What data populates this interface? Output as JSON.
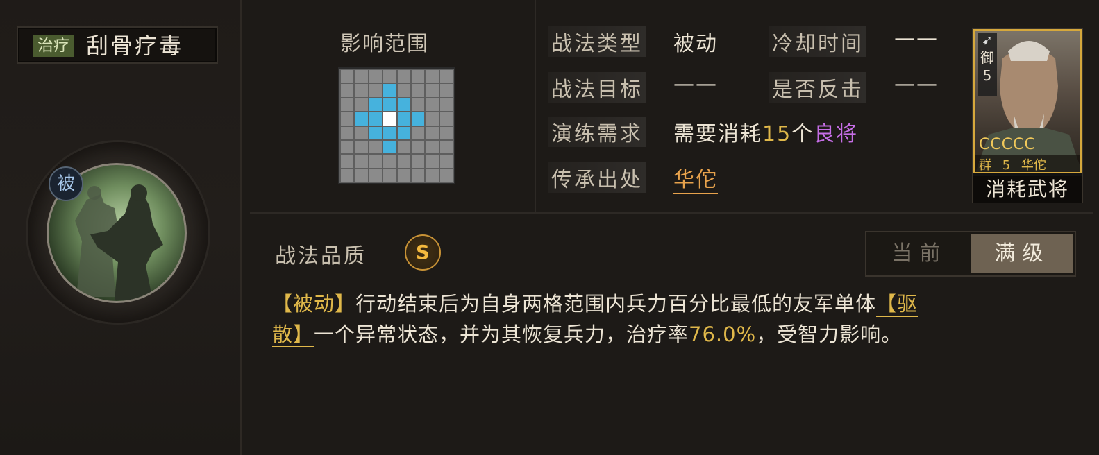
{
  "skill": {
    "type_tag": "治疗",
    "name": "刮骨疗毒",
    "passive_badge": "被",
    "icon": "silhouette-figures-icon"
  },
  "range": {
    "title": "影响范围",
    "grid_size": 8,
    "blue_cells": [
      [
        1,
        3
      ],
      [
        2,
        2
      ],
      [
        2,
        3
      ],
      [
        2,
        4
      ],
      [
        3,
        1
      ],
      [
        3,
        2
      ],
      [
        3,
        4
      ],
      [
        3,
        5
      ],
      [
        4,
        2
      ],
      [
        4,
        3
      ],
      [
        4,
        4
      ],
      [
        5,
        3
      ]
    ],
    "center_cell": [
      3,
      3
    ]
  },
  "attributes": {
    "type_label": "战法类型",
    "type_value": "被动",
    "cooldown_label": "冷却时间",
    "cooldown_value": "——",
    "target_label": "战法目标",
    "target_value": "——",
    "counter_label": "是否反击",
    "counter_value": "——",
    "drill_label": "演练需求",
    "drill_prefix": "需要消耗",
    "drill_count": "15",
    "drill_unit": "个",
    "drill_quality": "良将",
    "source_label": "传承出处",
    "source_value": "华佗"
  },
  "general": {
    "unit_icon": "arrow-icon",
    "unit_name": "御",
    "cost": "5",
    "stars": "CCCCC",
    "faction": "群",
    "level": "5",
    "name": "华佗",
    "consume_label": "消耗武将"
  },
  "quality": {
    "label": "战法品质",
    "grade": "S"
  },
  "toggle": {
    "current": "当前",
    "max": "满级"
  },
  "description": {
    "tag": "【被动】",
    "text1": "行动结束后为自身两格范围内兵力百分比最低的友军单体",
    "link_part1": "【驱",
    "link_part2": "散】",
    "text2": "一个异常状态，并为其恢复兵力，治疗率",
    "rate": "76.0%",
    "text3": "，受智力影响。"
  },
  "colors": {
    "accent_gold": "#e0b84a",
    "quality_purple": "#c66ee6",
    "source_orange": "#e7a24c",
    "range_blue": "#46b2dd",
    "heal_tag_green": "#4a5b2f"
  }
}
